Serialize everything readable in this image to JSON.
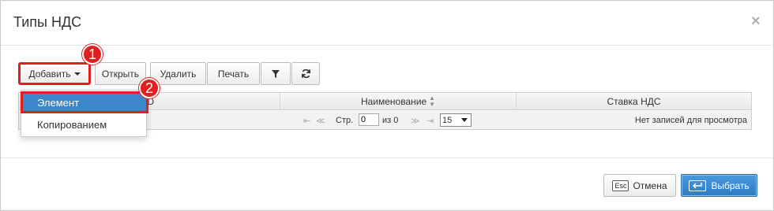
{
  "dialog": {
    "title": "Типы НДС",
    "close_label": "×"
  },
  "toolbar": {
    "add_label": "Добавить",
    "open_label": "Открыть",
    "delete_label": "Удалить",
    "print_label": "Печать",
    "filter_icon": "filter-icon",
    "refresh_icon": "refresh-icon"
  },
  "badges": {
    "first": "1",
    "second": "2"
  },
  "dropdown": {
    "items": [
      {
        "label": "Элемент",
        "selected": true
      },
      {
        "label": "Копированием",
        "selected": false
      }
    ]
  },
  "grid": {
    "columns": [
      {
        "label": "ID"
      },
      {
        "label": "Наименование",
        "sortable": true
      },
      {
        "label": "Ставка НДС"
      }
    ],
    "pager": {
      "first": "⇤",
      "prev": "≪",
      "page_label": "Стр.",
      "page_value": "0",
      "of_label": "из 0",
      "next": "≫",
      "last": "⇥",
      "page_size": "15",
      "no_records": "Нет записей для просмотра"
    }
  },
  "footer": {
    "esc_key": "Esc",
    "cancel_label": "Отмена",
    "select_label": "Выбрать"
  },
  "colors": {
    "accent_red": "#e02020",
    "primary_blue": "#3b87c9"
  }
}
